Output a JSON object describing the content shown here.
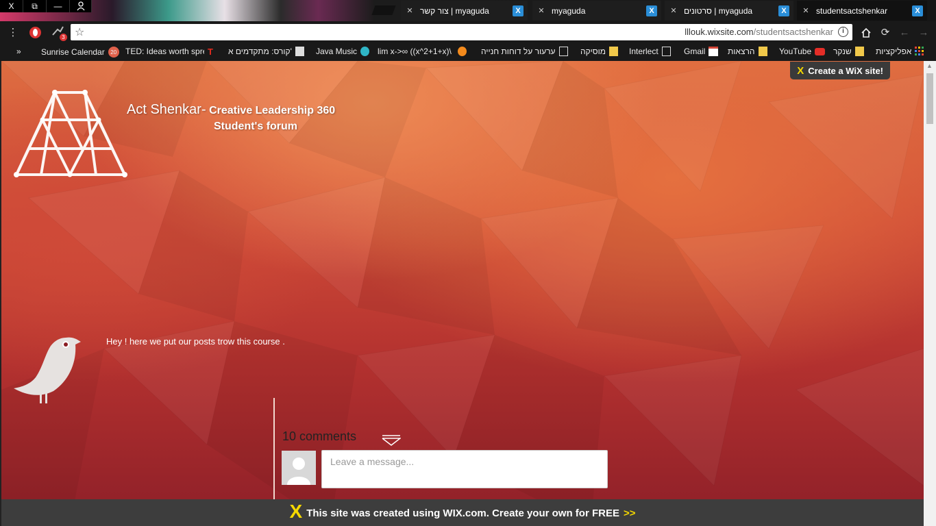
{
  "tabs": [
    {
      "title": "צור קשר | myaguda",
      "active": false
    },
    {
      "title": "myaguda",
      "active": false
    },
    {
      "title": "סרטונים | myaguda",
      "active": false
    },
    {
      "title": "studentsactshenkar",
      "active": true
    }
  ],
  "window_controls": {
    "close": "X",
    "restore": "⧉",
    "minimize": "—"
  },
  "address_bar": {
    "domain": "lllouk.wixsite.com",
    "path": "/studentsactshenkar",
    "extension_badge": "3"
  },
  "bookmarks": [
    {
      "label": "Sunrise Calendar",
      "icon": "sunrise-icon",
      "badge": "20"
    },
    {
      "label": "TED: Ideas worth spre",
      "icon": "ted-icon"
    },
    {
      "label": "קורס: מתקדמים א'",
      "icon": "course-icon"
    },
    {
      "label": "Java Music",
      "icon": "music-icon"
    },
    {
      "label": "lim x->∞ ((x^2+1+x)\\",
      "icon": "wolfram-icon"
    },
    {
      "label": "ערעור על דוחות חנייה",
      "icon": "doc-icon"
    },
    {
      "label": "מוסיקה",
      "icon": "folder-icon"
    },
    {
      "label": "Interlect",
      "icon": "doc-icon"
    },
    {
      "label": "Gmail",
      "icon": "gmail-icon"
    },
    {
      "label": "הרצאות",
      "icon": "folder-icon"
    },
    {
      "label": "YouTube",
      "icon": "youtube-icon"
    },
    {
      "label": "שנקר",
      "icon": "folder-icon"
    },
    {
      "label": "אפליקציות",
      "icon": "apps-icon"
    }
  ],
  "bookmarks_more": "»",
  "site": {
    "title_main": "Act Shenkar-",
    "title_sub": "Creative Leadership 360",
    "subtitle": "Student's forum",
    "intro": "Hey ! here we put our posts trow this course .",
    "create_wix": "Create a WiX site!"
  },
  "comments": {
    "count_label": "10 comments",
    "placeholder": "Leave a message..."
  },
  "wix_banner": {
    "text": "This site was created using WIX.com. Create your own for FREE",
    "more": ">>"
  },
  "colors": {
    "wix_yellow": "#f5d800",
    "page_red": "#c23b33"
  }
}
